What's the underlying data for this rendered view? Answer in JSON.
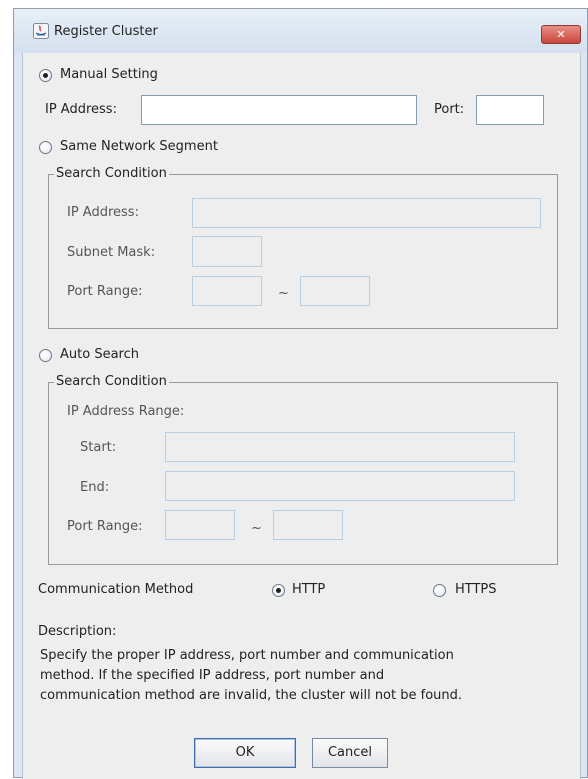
{
  "window": {
    "title": "Register Cluster",
    "close_glyph": "✕"
  },
  "manual": {
    "label": "Manual Setting",
    "ip_label": "IP Address:",
    "ip_value": "",
    "port_label": "Port:",
    "port_value": ""
  },
  "same_segment": {
    "label": "Same Network Segment",
    "group_title": "Search Condition",
    "ip_label": "IP Address:",
    "subnet_label": "Subnet Mask:",
    "port_range_label": "Port Range:",
    "tilde": "~"
  },
  "auto_search": {
    "label": "Auto Search",
    "group_title": "Search Condition",
    "ip_range_label": "IP Address Range:",
    "start_label": "Start:",
    "end_label": "End:",
    "port_range_label": "Port Range:",
    "tilde": "~"
  },
  "communication": {
    "label": "Communication Method",
    "http_label": "HTTP",
    "https_label": "HTTPS",
    "selected": "HTTP"
  },
  "description": {
    "label": "Description:",
    "lines": [
      "Specify the proper IP address, port number and communication",
      "method. If the specified IP address, port number and",
      "communication method are invalid, the cluster will not be found."
    ]
  },
  "buttons": {
    "ok_label": "OK",
    "cancel_label": "Cancel"
  },
  "colors": {
    "close_button": "#c9463d",
    "field_border_disabled": "#b8cfe4",
    "dialog_bg": "#eeeeee"
  }
}
